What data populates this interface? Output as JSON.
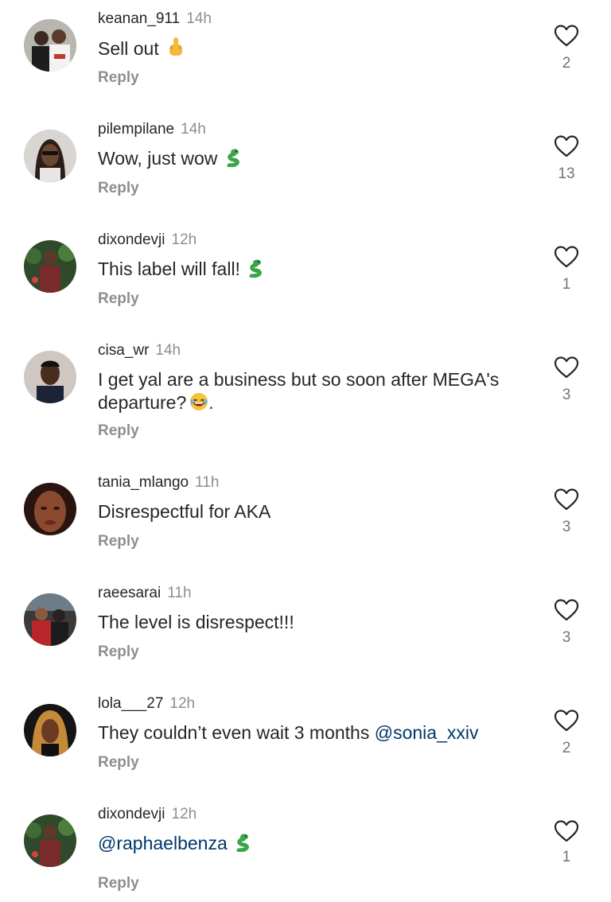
{
  "comments": [
    {
      "username": "keanan_911",
      "time": "14h",
      "text": "Sell out",
      "emoji": "middle-finger-icon",
      "reply_label": "Reply",
      "likes": "2"
    },
    {
      "username": "pilempilane",
      "time": "14h",
      "text": "Wow, just wow",
      "emoji": "snake-icon",
      "reply_label": "Reply",
      "likes": "13"
    },
    {
      "username": "dixondevji",
      "time": "12h",
      "text": "This label will fall!",
      "emoji": "snake-icon",
      "reply_label": "Reply",
      "likes": "1"
    },
    {
      "username": "cisa_wr",
      "time": "14h",
      "text_line1": "I get yal are a business but so soon after MEGA's",
      "text_line2_a": "departure?",
      "text_line2_b": ".",
      "emoji": "laughing-tears-icon",
      "reply_label": "Reply",
      "likes": "3"
    },
    {
      "username": "tania_mlango",
      "time": "11h",
      "text": "Disrespectful for AKA",
      "reply_label": "Reply",
      "likes": "3"
    },
    {
      "username": "raeesarai",
      "time": "11h",
      "text": "The level is disrespect!!!",
      "reply_label": "Reply",
      "likes": "3"
    },
    {
      "username": "lola___27",
      "time": "12h",
      "text": "They couldn’t even wait 3 months",
      "mention": "@sonia_xxiv",
      "reply_label": "Reply",
      "likes": "2"
    },
    {
      "username": "dixondevji",
      "time": "12h",
      "mention": "@raphaelbenza",
      "emoji": "snake-icon",
      "reply_label": "Reply",
      "likes": "1"
    }
  ],
  "colors": {
    "text": "#262626",
    "secondary": "#8e8e8e",
    "mention": "#00376b",
    "heart_outline": "#262626"
  }
}
